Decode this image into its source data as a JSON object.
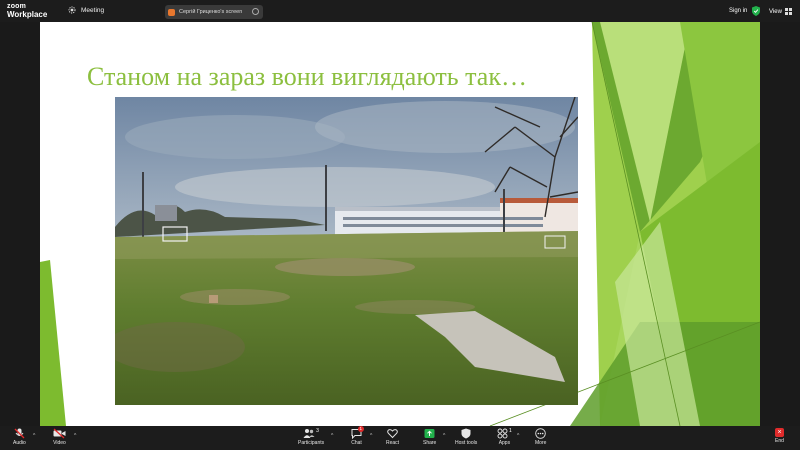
{
  "app": {
    "logo_line1": "zoom",
    "logo_line2": "Workplace"
  },
  "topbar": {
    "meeting_label": "Meeting",
    "shared_screen_label": "Сергій Гриценко's screen",
    "sign_in_label": "Sign in",
    "view_label": "View"
  },
  "slide": {
    "title": "Станом на зараз вони виглядають так…",
    "title_color": "#8cbf3f"
  },
  "toolbar": {
    "audio": "Audio",
    "video": "Video",
    "participants": "Participants",
    "participants_count": "3",
    "chat": "Chat",
    "chat_badge": "1",
    "react": "React",
    "share": "Share",
    "host_tools": "Host tools",
    "apps": "Apps",
    "apps_count": "1",
    "more": "More",
    "end": "End"
  },
  "colors": {
    "accent_green": "#7dbb2f",
    "end_red": "#e02b2b",
    "share_green": "#22b14c"
  }
}
